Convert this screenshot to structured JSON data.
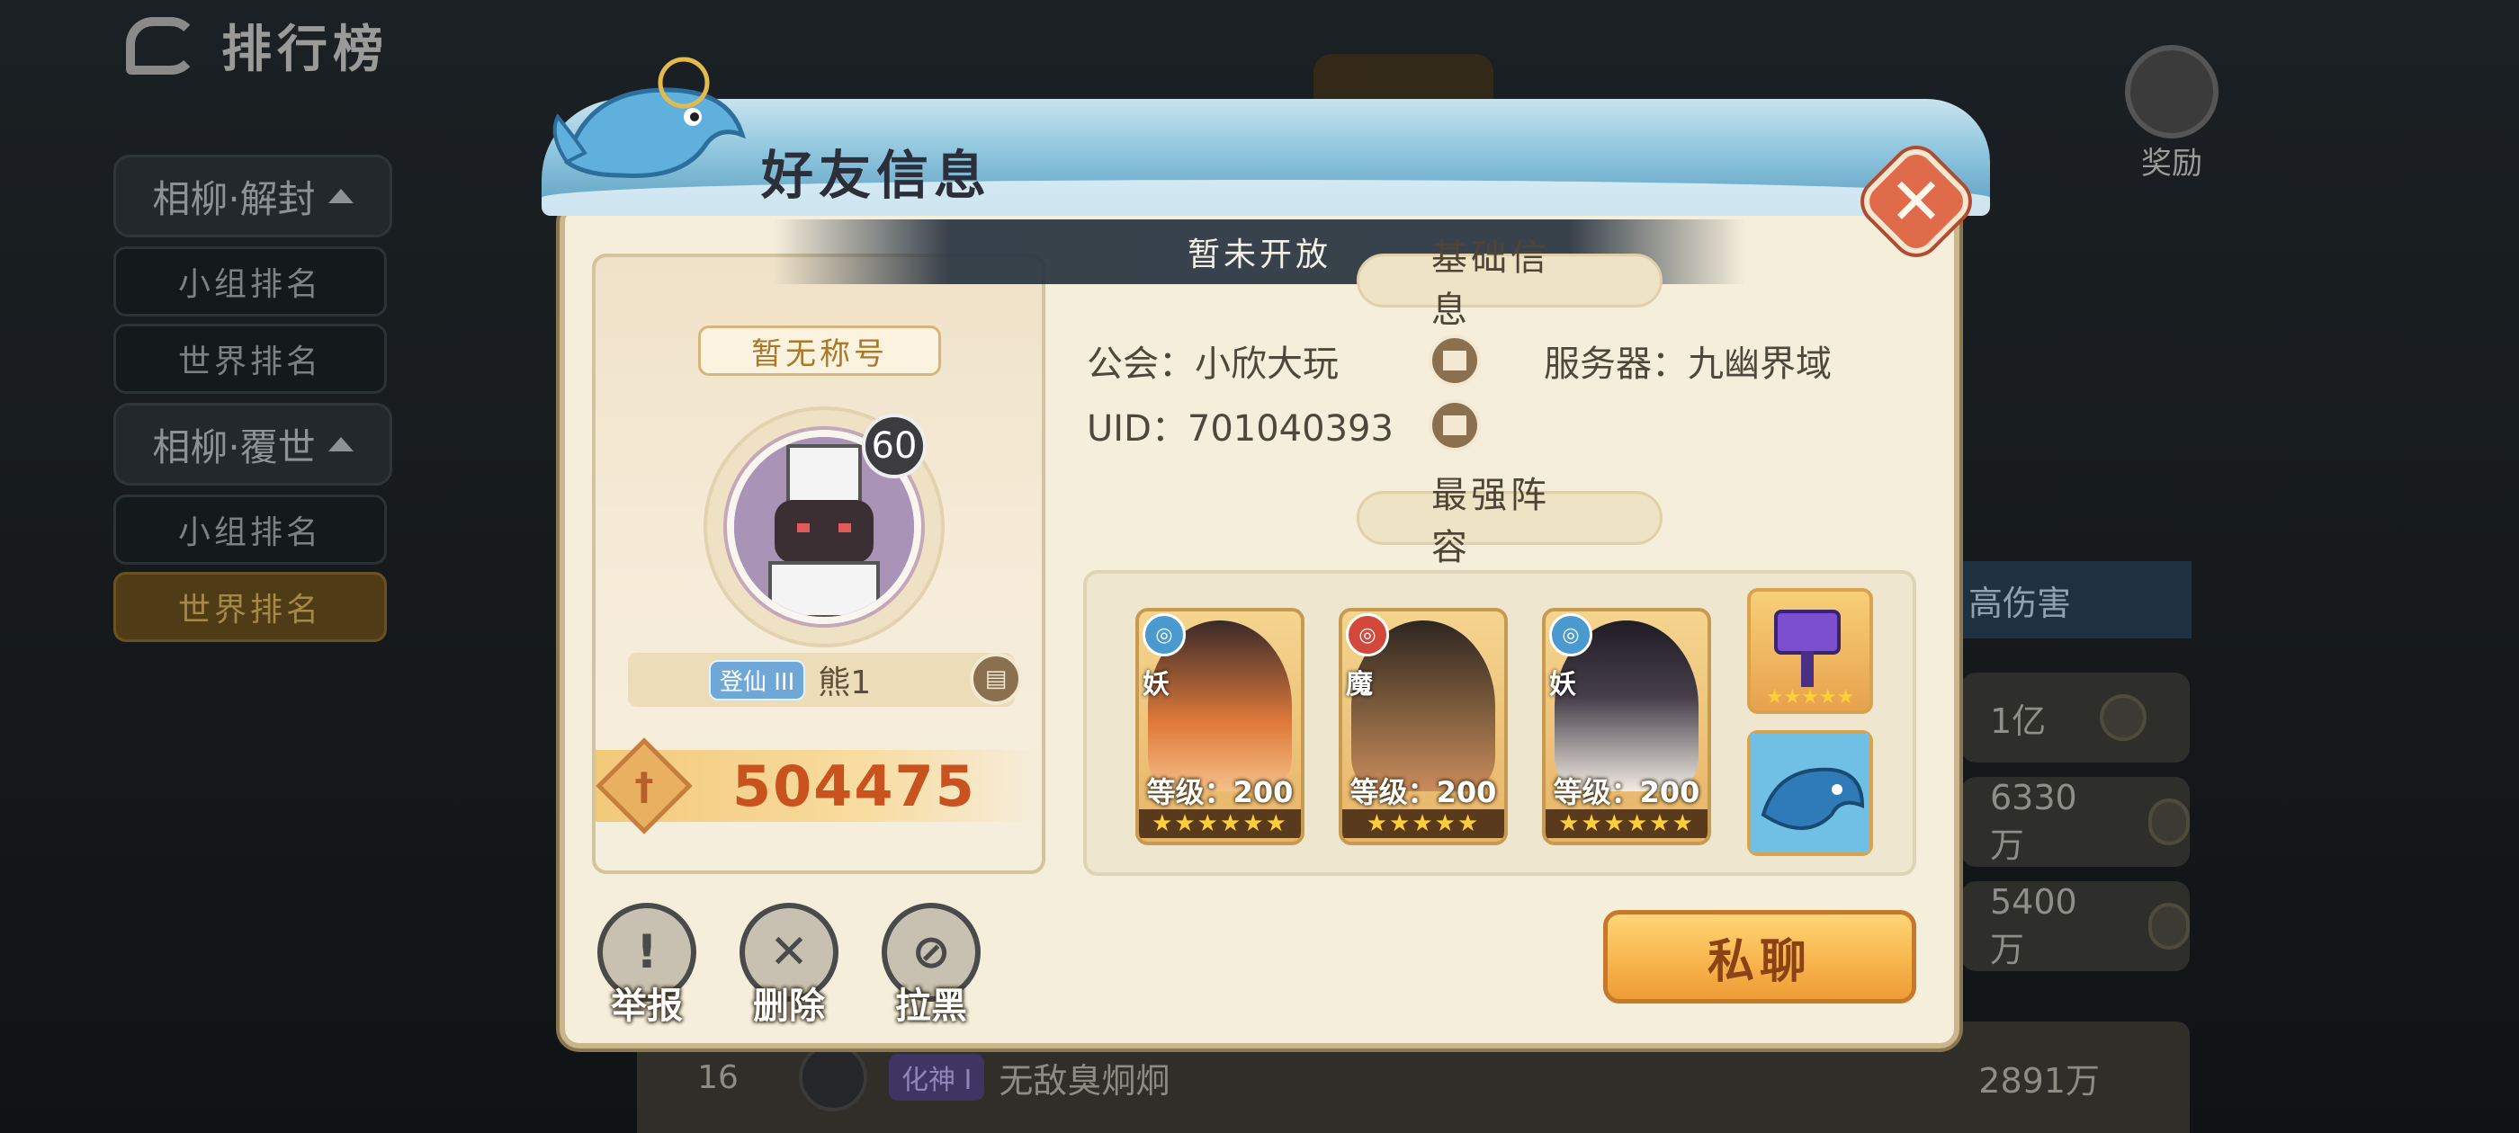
{
  "background": {
    "page_title": "排行榜",
    "sidebar": [
      {
        "type": "group",
        "label": "相柳·解封"
      },
      {
        "type": "item",
        "label": "小组排名"
      },
      {
        "type": "item",
        "label": "世界排名"
      },
      {
        "type": "group",
        "label": "相柳·覆世"
      },
      {
        "type": "item",
        "label": "小组排名"
      },
      {
        "type": "item",
        "label": "世界排名",
        "active": true
      }
    ],
    "reward_label": "奖励",
    "damage_tab": "高伤害",
    "rank_values": [
      "1亿",
      "6330万",
      "5400万"
    ],
    "bottom_row": {
      "rank": "16",
      "realm": "化神 I",
      "name": "无敌臭炯炯",
      "value": "2891万"
    }
  },
  "dialog": {
    "title": "好友信息",
    "notice": "暂未开放",
    "close_label": "✕",
    "profile": {
      "title_tag": "暂无称号",
      "level": "60",
      "realm": "登仙 III",
      "name": "熊1",
      "power": "504475"
    },
    "basic_info": {
      "section_title": "基础信息",
      "guild_label": "公会：小欣大玩",
      "server_label": "服务器：九幽界域",
      "uid_label": "UID：701040393"
    },
    "lineup": {
      "section_title": "最强阵容",
      "heroes": [
        {
          "race": "妖",
          "faction": "water",
          "level": "等级：200",
          "stars": "★★★★★★"
        },
        {
          "race": "魔",
          "faction": "fire",
          "level": "等级：200",
          "stars": "★★★★★"
        },
        {
          "race": "妖",
          "faction": "water",
          "level": "等级：200",
          "stars": "★★★★★★"
        }
      ],
      "equips": [
        {
          "icon": "purple-hammer-icon",
          "stars": "★★★★★"
        },
        {
          "icon": "blue-whale-pet-icon",
          "stars": ""
        }
      ]
    },
    "actions": [
      {
        "label": "举报",
        "icon": "report-icon"
      },
      {
        "label": "删除",
        "icon": "delete-friend-icon"
      },
      {
        "label": "拉黑",
        "icon": "block-icon"
      }
    ],
    "chat_button": "私聊"
  },
  "colors": {
    "dialog_bg": "#f5eedb",
    "accent_orange": "#f7b24a",
    "power_text": "#c9531f",
    "water_faction": "#4a9ad0",
    "fire_faction": "#d2483a"
  }
}
